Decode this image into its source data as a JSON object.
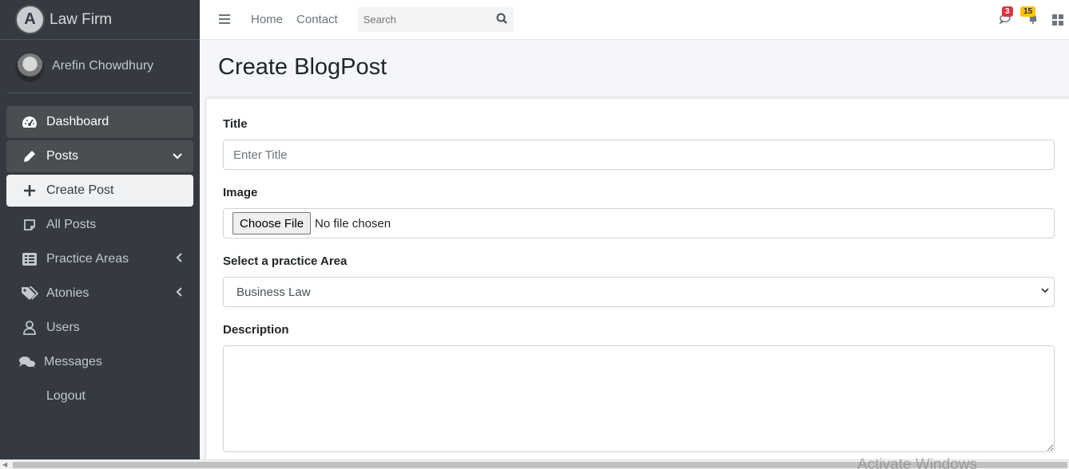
{
  "brand": {
    "logo_letter": "A",
    "name": "Law Firm"
  },
  "user": {
    "name": "Arefin Chowdhury"
  },
  "sidebar": {
    "items": [
      {
        "label": "Dashboard",
        "icon": "tachometer-icon"
      },
      {
        "label": "Posts",
        "icon": "pencil-icon"
      },
      {
        "label": "Create Post",
        "icon": "plus-icon"
      },
      {
        "label": "All Posts",
        "icon": "note-icon"
      },
      {
        "label": "Practice Areas",
        "icon": "list-icon"
      },
      {
        "label": "Atonies",
        "icon": "tags-icon"
      },
      {
        "label": "Users",
        "icon": "user-icon"
      },
      {
        "label": "Messages",
        "icon": "comments-icon"
      },
      {
        "label": "Logout",
        "icon": ""
      }
    ]
  },
  "navbar": {
    "links": [
      "Home",
      "Contact"
    ],
    "search_placeholder": "Search",
    "messages_count": "3",
    "notifications_count": "15"
  },
  "page": {
    "title": "Create BlogPost"
  },
  "form": {
    "title_label": "Title",
    "title_placeholder": "Enter Title",
    "image_label": "Image",
    "file_button": "Choose File",
    "file_status": "No file chosen",
    "practice_label": "Select a practice Area",
    "practice_selected": "Business Law",
    "description_label": "Description"
  },
  "watermark": "Activate Windows"
}
